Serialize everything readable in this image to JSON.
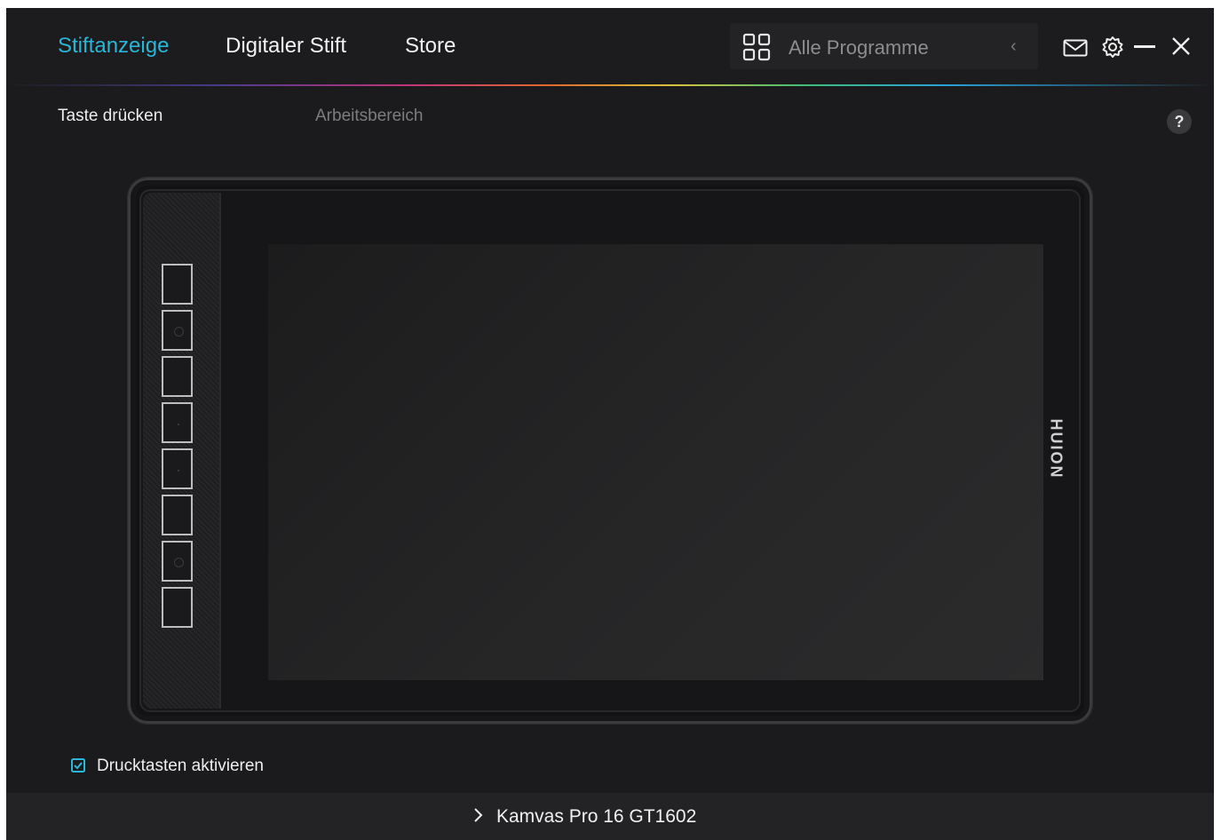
{
  "nav": {
    "tabs": [
      {
        "label": "Stiftanzeige",
        "active": true
      },
      {
        "label": "Digitaler Stift",
        "active": false
      },
      {
        "label": "Store",
        "active": false
      }
    ],
    "program_selector": {
      "label": "Alle Programme",
      "icon": "grid-icon",
      "arrow_icon": "chevron-left-icon"
    },
    "window_icons": [
      "mail-icon",
      "gear-icon",
      "minimize-icon",
      "close-icon"
    ]
  },
  "subtabs": [
    {
      "label": "Taste drücken",
      "active": true
    },
    {
      "label": "Arbeitsbereich",
      "active": false
    }
  ],
  "help": {
    "label": "?"
  },
  "tablet": {
    "brand": "HUION",
    "key_count": 8
  },
  "options": {
    "enable_keys": {
      "label": "Drucktasten aktivieren",
      "checked": true
    }
  },
  "footer": {
    "device_name": "Kamvas Pro 16 GT1602"
  },
  "colors": {
    "accent": "#27b6d8",
    "background": "#1b1b1d",
    "text": "#f2f2f2"
  }
}
